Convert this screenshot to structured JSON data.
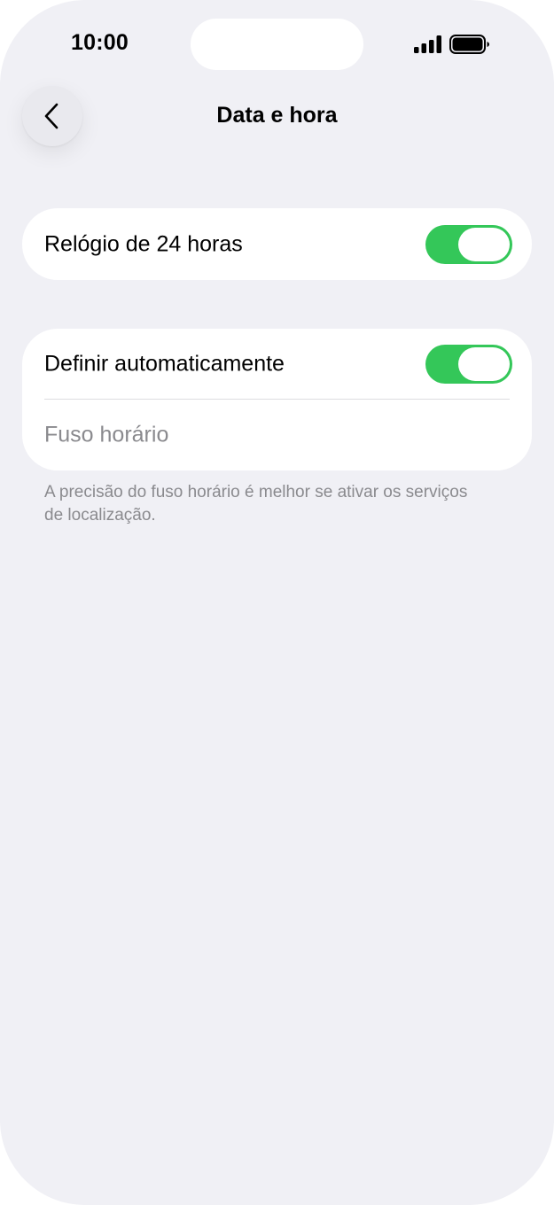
{
  "status_bar": {
    "time": "10:00",
    "signal_icon": "cellular-signal-icon",
    "battery_icon": "battery-icon"
  },
  "nav": {
    "back_icon": "chevron-left-icon",
    "title": "Data e hora"
  },
  "settings": {
    "clock_24h": {
      "label": "Relógio de 24 horas",
      "enabled": true
    },
    "auto_set": {
      "label": "Definir automaticamente",
      "enabled": true
    },
    "time_zone": {
      "label": "Fuso horário"
    },
    "footnote": "A precisão do fuso horário é melhor se ativar os serviços de localização."
  },
  "colors": {
    "toggle_on": "#34c759",
    "background": "#f0f0f5",
    "card": "#ffffff",
    "secondary_text": "#8a8a8e"
  }
}
